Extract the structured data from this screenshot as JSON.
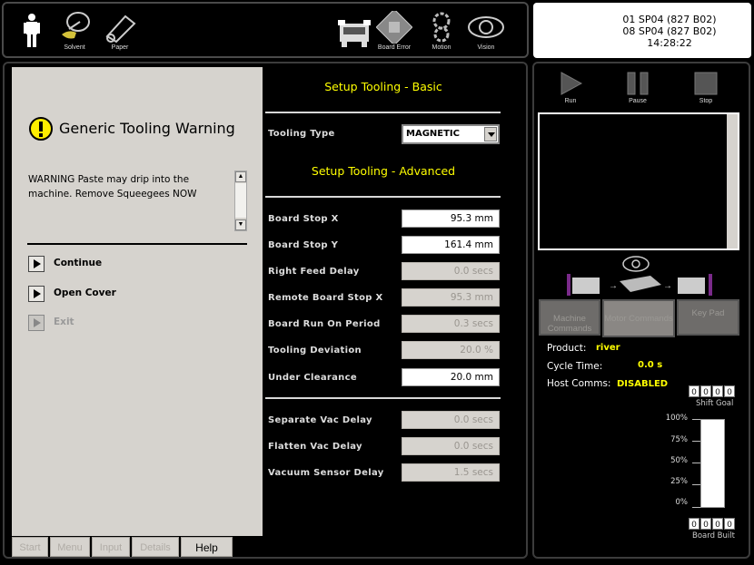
{
  "toolbar": {
    "items": [
      {
        "label": "",
        "icon": "operator-icon"
      },
      {
        "label": "Solvent",
        "icon": "solvent-icon"
      },
      {
        "label": "Paper",
        "icon": "paper-icon"
      },
      {
        "label": "",
        "icon": "printer-machine-icon"
      },
      {
        "label": "Board Error",
        "icon": "board-error-icon"
      },
      {
        "label": "Motion",
        "icon": "motion-icon"
      },
      {
        "label": "Vision",
        "icon": "vision-icon"
      }
    ]
  },
  "status": {
    "line1": "01 SP04 (827 B02)",
    "line2": "08 SP04 (827 B02)",
    "time": "14:28:22"
  },
  "dialog": {
    "title": "Generic Tooling Warning",
    "message": "WARNING Paste may drip into the machine. Remove Squeegees NOW",
    "buttons": [
      {
        "label": "Continue",
        "enabled": true
      },
      {
        "label": "Open Cover",
        "enabled": true
      },
      {
        "label": "Exit",
        "enabled": false
      }
    ]
  },
  "bottom_tabs": [
    "Start",
    "Menu",
    "Input",
    "Details",
    "Help"
  ],
  "setup": {
    "title_basic": "Setup Tooling - Basic",
    "tooling_type_label": "Tooling Type",
    "tooling_type_value": "MAGNETIC",
    "title_advanced": "Setup Tooling - Advanced",
    "group1": [
      {
        "label": "Board Stop X",
        "value": "95.3 mm",
        "editable": true
      },
      {
        "label": "Board Stop Y",
        "value": "161.4 mm",
        "editable": true
      },
      {
        "label": "Right Feed Delay",
        "value": "0.0 secs",
        "editable": false
      },
      {
        "label": "Remote Board Stop X",
        "value": "95.3 mm",
        "editable": false
      },
      {
        "label": "Board Run On Period",
        "value": "0.3 secs",
        "editable": false
      },
      {
        "label": "Tooling Deviation",
        "value": "20.0 %",
        "editable": false
      },
      {
        "label": "Under Clearance",
        "value": "20.0 mm",
        "editable": true
      }
    ],
    "group2": [
      {
        "label": "Separate Vac Delay",
        "value": "0.0 secs",
        "editable": false
      },
      {
        "label": "Flatten Vac Delay",
        "value": "0.0 secs",
        "editable": false
      },
      {
        "label": "Vacuum Sensor Delay",
        "value": "1.5 secs",
        "editable": false
      }
    ]
  },
  "controls": {
    "run": "Run",
    "pause": "Pause",
    "stop": "Stop"
  },
  "right_tabs": [
    "Machine Commands",
    "Motor Commands",
    "Key Pad"
  ],
  "info": {
    "product_label": "Product:",
    "product_value": "river",
    "cycle_label": "Cycle Time:",
    "cycle_value": "0.0 s",
    "host_label": "Host Comms:",
    "host_value": "DISABLED"
  },
  "shift_goal": {
    "digits": [
      "0",
      "0",
      "0",
      "0"
    ],
    "label": "Shift Goal"
  },
  "board_built": {
    "digits": [
      "0",
      "0",
      "0",
      "0"
    ],
    "label": "Board Built"
  },
  "gauge": {
    "scale": [
      "100%",
      "75%",
      "50%",
      "25%",
      "0%"
    ],
    "level": 0
  },
  "colors": {
    "accent": "#ffff00",
    "dialog_bg": "#d6d3ce"
  }
}
